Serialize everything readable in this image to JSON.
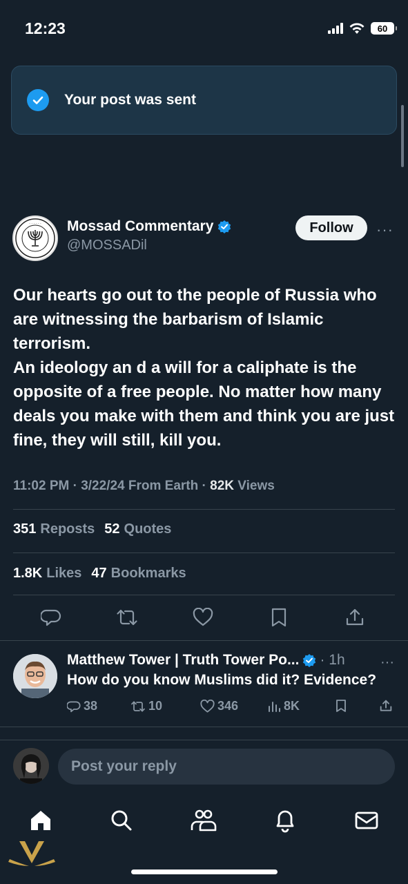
{
  "status_bar": {
    "time": "12:23",
    "battery": "60"
  },
  "toast": {
    "text": "Your post was sent",
    "icon": "check-circle-icon"
  },
  "post": {
    "author_name": "Mossad Commentary",
    "author_handle": "@MOSSADil",
    "verified": true,
    "follow_label": "Follow",
    "more": "···",
    "body": "Our hearts go out to the people of Russia who are witnessing the barbarism of Islamic terrorism.\nAn ideology an d a will for a caliphate is the opposite of a free people. No matter how many deals you make with them and think you are just fine, they will still, kill you.",
    "meta_time": "11:02 PM · 3/22/24 From Earth · ",
    "meta_views_num": "82K",
    "meta_views_label": " Views",
    "reposts_num": "351",
    "reposts_label": "Reposts",
    "quotes_num": "52",
    "quotes_label": "Quotes",
    "likes_num": "1.8K",
    "likes_label": "Likes",
    "bookmarks_num": "47",
    "bookmarks_label": "Bookmarks"
  },
  "actions": [
    "reply-icon",
    "repost-icon",
    "like-icon",
    "bookmark-icon",
    "share-icon"
  ],
  "reply": {
    "name": "Matthew Tower | Truth Tower Po...",
    "verified": true,
    "time": "· 1h",
    "more": "···",
    "text": "How do you know Muslims did it? Evidence?",
    "replies": "38",
    "reposts": "10",
    "likes": "346",
    "views": "8K"
  },
  "compose": {
    "placeholder": "Post your reply"
  },
  "tabbar": [
    "home-icon",
    "search-icon",
    "communities-icon",
    "notifications-icon",
    "messages-icon"
  ],
  "colors": {
    "background": "#15202b",
    "accent": "#1d9bf0",
    "muted": "#8b98a5"
  }
}
